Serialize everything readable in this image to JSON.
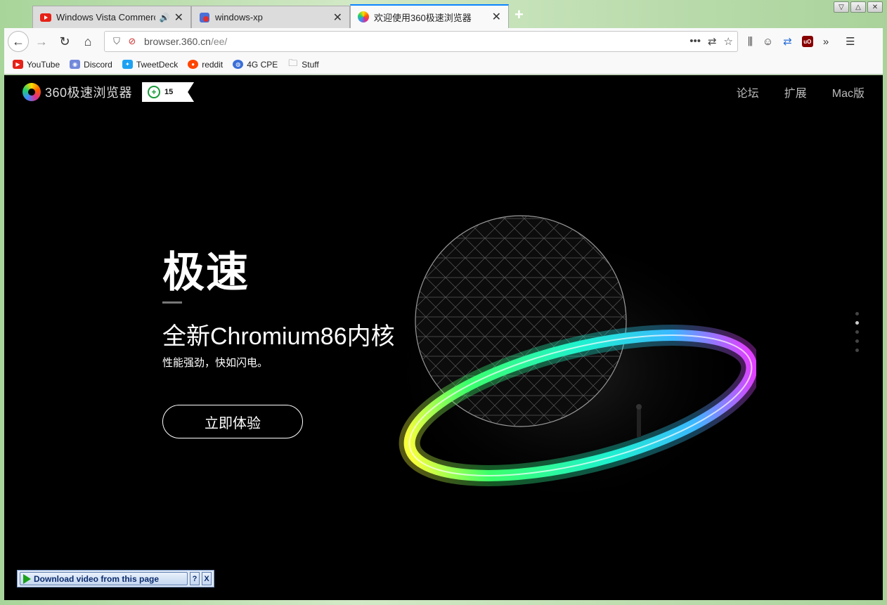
{
  "browser": {
    "tabs": [
      {
        "title": "Windows Vista Commercial",
        "favicon": "youtube-icon",
        "audio": true,
        "active": false
      },
      {
        "title": "windows-xp",
        "favicon": "recording-icon",
        "audio": false,
        "active": false
      },
      {
        "title": "欢迎使用360极速浏览器",
        "favicon": "360-browser-icon",
        "audio": false,
        "active": true
      }
    ],
    "url_host": "browser.360.cn",
    "url_path": "/ee/",
    "bookmarks": [
      {
        "label": "YouTube",
        "icon": "youtube-icon",
        "color": "#e62117"
      },
      {
        "label": "Discord",
        "icon": "discord-icon",
        "color": "#7289da"
      },
      {
        "label": "TweetDeck",
        "icon": "tweetdeck-icon",
        "color": "#1da1f2"
      },
      {
        "label": "reddit",
        "icon": "reddit-icon",
        "color": "#ff4500"
      },
      {
        "label": "4G CPE",
        "icon": "globe-icon",
        "color": "#3a6fd8"
      },
      {
        "label": "Stuff",
        "icon": "folder-icon",
        "color": "#888888"
      }
    ]
  },
  "site": {
    "logo_text": "360极速浏览器",
    "badge_text": "15",
    "nav": [
      "论坛",
      "扩展",
      "Mac版"
    ],
    "hero_title": "极速",
    "hero_subtitle": "全新Chromium86内核",
    "hero_desc": "性能强劲，快如闪电。",
    "hero_button": "立即体验"
  },
  "download_bar": {
    "label": "Download video from this page",
    "help": "?",
    "close": "X"
  }
}
